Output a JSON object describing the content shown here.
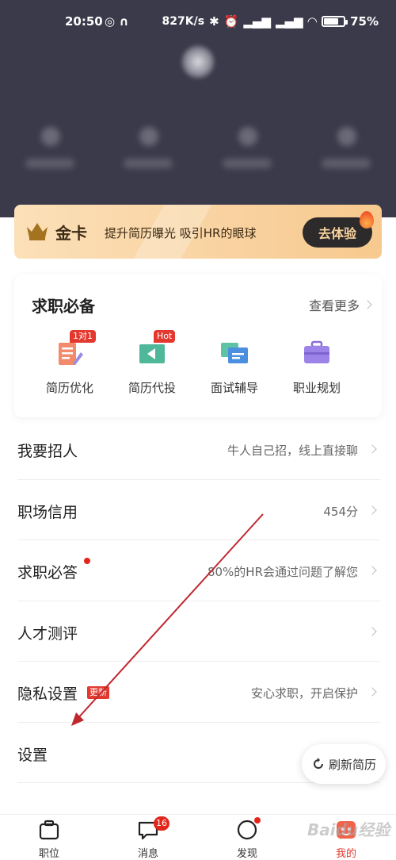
{
  "status_bar": {
    "time": "20:50",
    "net_speed": "827K/s",
    "battery_percent": "75",
    "battery_level": 0.75,
    "battery_suffix": "%"
  },
  "gold_card": {
    "title": "金卡",
    "description": "提升简历曝光  吸引HR的眼球",
    "button": "去体验"
  },
  "essentials": {
    "title": "求职必备",
    "more": "查看更多",
    "items": [
      {
        "label": "简历优化",
        "badge": "1对1",
        "icon": "resume-optimize-icon"
      },
      {
        "label": "简历代投",
        "badge": "Hot",
        "icon": "resume-send-icon"
      },
      {
        "label": "面试辅导",
        "badge": "",
        "icon": "interview-coach-icon"
      },
      {
        "label": "职业规划",
        "badge": "",
        "icon": "career-plan-icon"
      }
    ]
  },
  "menu": [
    {
      "label": "我要招人",
      "value": "牛人自己招，线上直接聊"
    },
    {
      "label": "职场信用",
      "value": "454分"
    },
    {
      "label": "求职必答",
      "value": "80%的HR会通过问题了解您"
    },
    {
      "label": "人才测评",
      "value": ""
    },
    {
      "label": "隐私设置",
      "value": "安心求职，开启保护",
      "badge": "更新"
    },
    {
      "label": "设置",
      "value": ""
    }
  ],
  "refresh_button": "刷新简历",
  "tabbar": {
    "items": [
      {
        "label": "职位",
        "badge": ""
      },
      {
        "label": "消息",
        "badge": "16"
      },
      {
        "label": "发现",
        "badge": ""
      },
      {
        "label": "我的",
        "badge": ""
      }
    ]
  },
  "colors": {
    "accent_red": "#e2261c",
    "header_bg": "#3a3a4a",
    "gold": "#f9d3a2",
    "annotation_arrow": "#c0272d"
  },
  "watermark": "Baidu经验"
}
